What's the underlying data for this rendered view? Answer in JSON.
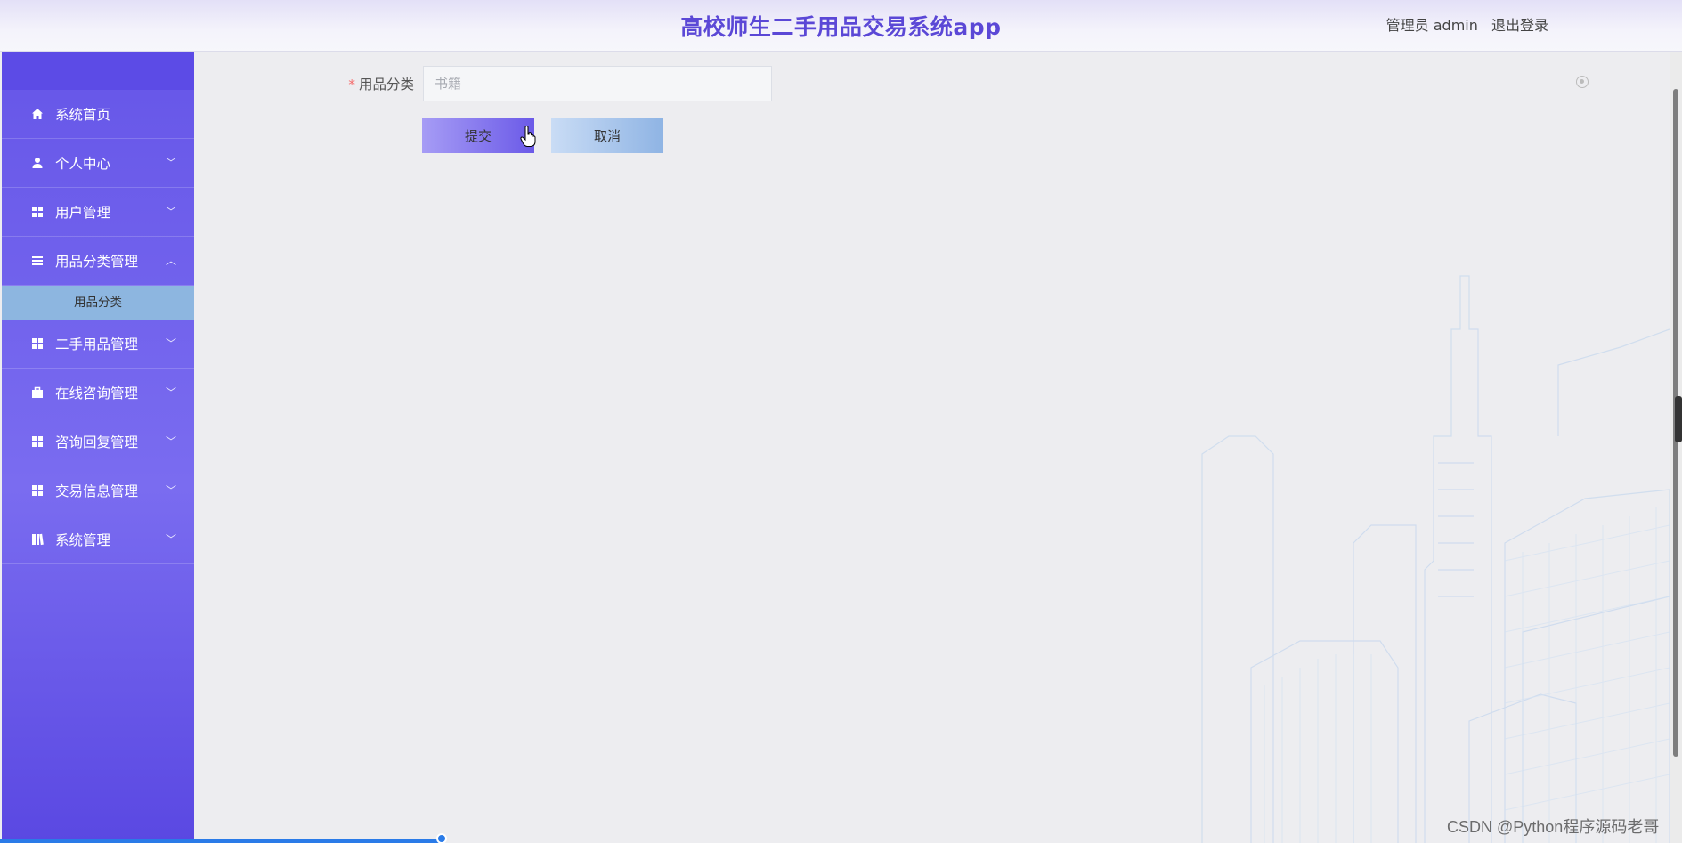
{
  "header": {
    "app_title": "高校师生二手用品交易系统app",
    "user_label": "管理员 admin",
    "logout_label": "退出登录"
  },
  "sidebar": {
    "items": [
      {
        "label": "系统首页",
        "icon": "home-icon",
        "expandable": false
      },
      {
        "label": "个人中心",
        "icon": "user-icon",
        "expandable": true
      },
      {
        "label": "用户管理",
        "icon": "grid-icon",
        "expandable": true
      },
      {
        "label": "用品分类管理",
        "icon": "list-icon",
        "expandable": true,
        "expanded": true
      },
      {
        "label": "二手用品管理",
        "icon": "grid-icon",
        "expandable": true
      },
      {
        "label": "在线咨询管理",
        "icon": "briefcase-icon",
        "expandable": true
      },
      {
        "label": "咨询回复管理",
        "icon": "grid-icon",
        "expandable": true
      },
      {
        "label": "交易信息管理",
        "icon": "grid-icon",
        "expandable": true
      },
      {
        "label": "系统管理",
        "icon": "book-icon",
        "expandable": true
      }
    ],
    "submenu": {
      "label": "用品分类"
    }
  },
  "form": {
    "field_label": "用品分类",
    "required_mark": "*",
    "field_value": "",
    "field_placeholder": "书籍",
    "submit_label": "提交",
    "cancel_label": "取消"
  },
  "watermark": "CSDN @Python程序源码老哥",
  "colors": {
    "accent": "#5b48d6",
    "sidebar": "#6656e8",
    "submenu_active": "#8db6e0",
    "required": "#f56c6c"
  }
}
